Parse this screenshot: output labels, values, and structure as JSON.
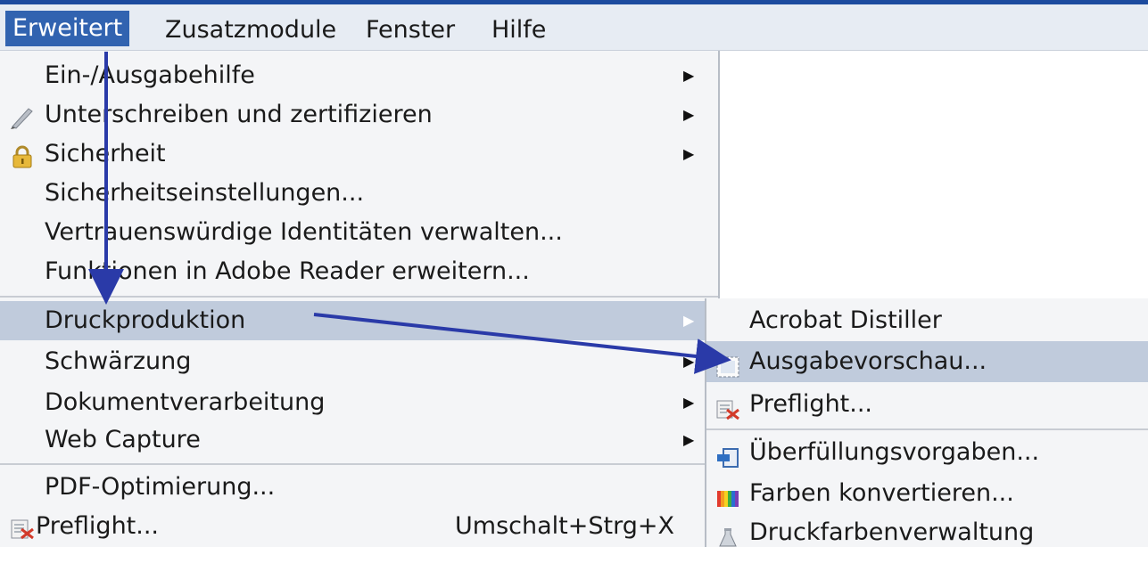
{
  "menubar": {
    "items": [
      {
        "label": "Erweitert",
        "active": true
      },
      {
        "label": "Zusatzmodule",
        "active": false
      },
      {
        "label": "Fenster",
        "active": false
      },
      {
        "label": "Hilfe",
        "active": false
      }
    ]
  },
  "menu": {
    "items": [
      {
        "label": "Ein-/Ausgabehilfe",
        "has_submenu": true
      },
      {
        "label": "Unterschreiben und zertifizieren",
        "has_submenu": true,
        "icon": "pen-icon"
      },
      {
        "label": "Sicherheit",
        "has_submenu": true,
        "icon": "lock-icon"
      },
      {
        "label": "Sicherheitseinstellungen...",
        "has_submenu": false
      },
      {
        "label": "Vertrauenswürdige Identitäten verwalten...",
        "has_submenu": false
      },
      {
        "label": "Funktionen in Adobe Reader erweitern...",
        "has_submenu": false
      },
      {
        "label": "Druckproduktion",
        "has_submenu": true,
        "highlighted": true
      },
      {
        "label": "Schwärzung",
        "has_submenu": true
      },
      {
        "label": "Dokumentverarbeitung",
        "has_submenu": true
      },
      {
        "label": "Web Capture",
        "has_submenu": true
      },
      {
        "label": "PDF-Optimierung...",
        "has_submenu": false
      },
      {
        "label": "Preflight...",
        "has_submenu": false,
        "icon": "preflight-icon",
        "shortcut": "Umschalt+Strg+X"
      }
    ]
  },
  "druckproduktion_submenu": {
    "items": [
      {
        "label": "Acrobat Distiller"
      },
      {
        "label": "Ausgabevorschau...",
        "icon": "output-preview-icon",
        "highlighted": true
      },
      {
        "label": "Preflight...",
        "icon": "preflight-icon"
      },
      {
        "label": "Überfüllungsvorgaben...",
        "icon": "trap-presets-icon"
      },
      {
        "label": "Farben konvertieren...",
        "icon": "convert-colors-icon"
      },
      {
        "label": "Druckfarbenverwaltung",
        "icon": "ink-manager-icon"
      }
    ]
  },
  "colors": {
    "menubar_active": "#3163b0",
    "highlight": "#c0cbdc",
    "annotation_arrow": "#2a3aa8"
  }
}
